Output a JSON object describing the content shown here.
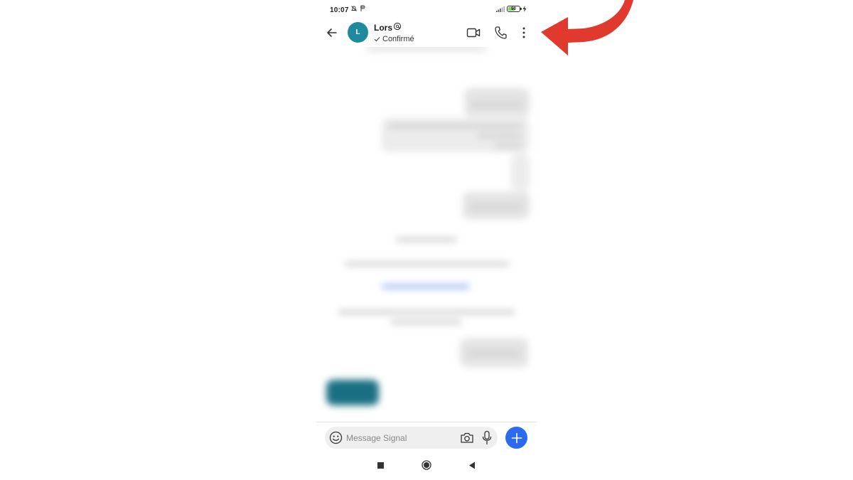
{
  "status_bar": {
    "time": "10:07",
    "battery_level": "50"
  },
  "header": {
    "avatar_initial": "L",
    "contact_name": "Lors",
    "contact_status": "Confirmé"
  },
  "composer": {
    "placeholder": "Message Signal"
  },
  "colors": {
    "accent": "#2c6bed",
    "avatar": "#1f8a9e",
    "annotation_arrow": "#e03a2f",
    "battery_fill": "#7ed957"
  },
  "icons": {
    "header": [
      "back-arrow-icon",
      "note-to-self-badge-icon",
      "video-call-icon",
      "phone-call-icon",
      "more-options-icon"
    ],
    "composer": [
      "emoji-icon",
      "camera-icon",
      "microphone-icon",
      "plus-icon"
    ],
    "navigation": [
      "recent-apps-icon",
      "home-icon",
      "nav-back-icon"
    ]
  }
}
